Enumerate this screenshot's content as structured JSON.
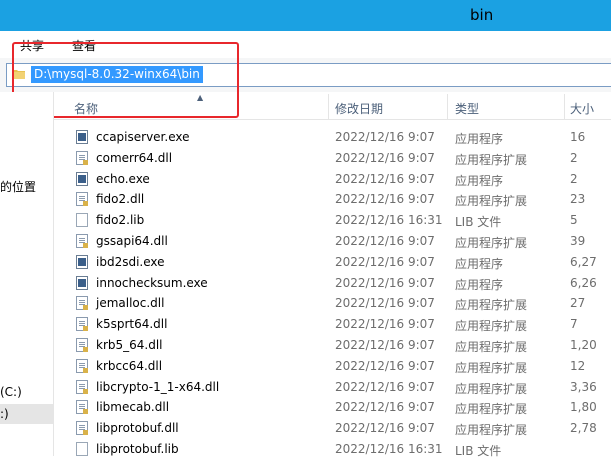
{
  "window": {
    "title": "bin"
  },
  "ribbon": {
    "tabs": [
      "共享",
      "查看"
    ]
  },
  "address": {
    "path": "D:\\mysql-8.0.32-winx64\\bin"
  },
  "sidebar": {
    "items": [
      "的位置",
      "(C:)",
      ":)"
    ]
  },
  "columns": {
    "name": "名称",
    "date": "修改日期",
    "type": "类型",
    "size": "大小"
  },
  "files": [
    {
      "name": "ccapiserver.exe",
      "date": "2022/12/16 9:07",
      "type": "应用程序",
      "size": "16",
      "kind": "exe"
    },
    {
      "name": "comerr64.dll",
      "date": "2022/12/16 9:07",
      "type": "应用程序扩展",
      "size": "2",
      "kind": "dll"
    },
    {
      "name": "echo.exe",
      "date": "2022/12/16 9:07",
      "type": "应用程序",
      "size": "2",
      "kind": "exe"
    },
    {
      "name": "fido2.dll",
      "date": "2022/12/16 9:07",
      "type": "应用程序扩展",
      "size": "23",
      "kind": "dll"
    },
    {
      "name": "fido2.lib",
      "date": "2022/12/16 16:31",
      "type": "LIB 文件",
      "size": "5",
      "kind": "lib"
    },
    {
      "name": "gssapi64.dll",
      "date": "2022/12/16 9:07",
      "type": "应用程序扩展",
      "size": "39",
      "kind": "dll"
    },
    {
      "name": "ibd2sdi.exe",
      "date": "2022/12/16 9:07",
      "type": "应用程序",
      "size": "6,27",
      "kind": "exe"
    },
    {
      "name": "innochecksum.exe",
      "date": "2022/12/16 9:07",
      "type": "应用程序",
      "size": "6,26",
      "kind": "exe"
    },
    {
      "name": "jemalloc.dll",
      "date": "2022/12/16 9:07",
      "type": "应用程序扩展",
      "size": "27",
      "kind": "dll"
    },
    {
      "name": "k5sprt64.dll",
      "date": "2022/12/16 9:07",
      "type": "应用程序扩展",
      "size": "7",
      "kind": "dll"
    },
    {
      "name": "krb5_64.dll",
      "date": "2022/12/16 9:07",
      "type": "应用程序扩展",
      "size": "1,20",
      "kind": "dll"
    },
    {
      "name": "krbcc64.dll",
      "date": "2022/12/16 9:07",
      "type": "应用程序扩展",
      "size": "12",
      "kind": "dll"
    },
    {
      "name": "libcrypto-1_1-x64.dll",
      "date": "2022/12/16 9:07",
      "type": "应用程序扩展",
      "size": "3,36",
      "kind": "dll"
    },
    {
      "name": "libmecab.dll",
      "date": "2022/12/16 9:07",
      "type": "应用程序扩展",
      "size": "1,80",
      "kind": "dll"
    },
    {
      "name": "libprotobuf.dll",
      "date": "2022/12/16 9:07",
      "type": "应用程序扩展",
      "size": "2,78",
      "kind": "dll"
    },
    {
      "name": "libprotobuf.lib",
      "date": "2022/12/16 16:31",
      "type": "LIB 文件",
      "size": "",
      "kind": "lib"
    }
  ]
}
